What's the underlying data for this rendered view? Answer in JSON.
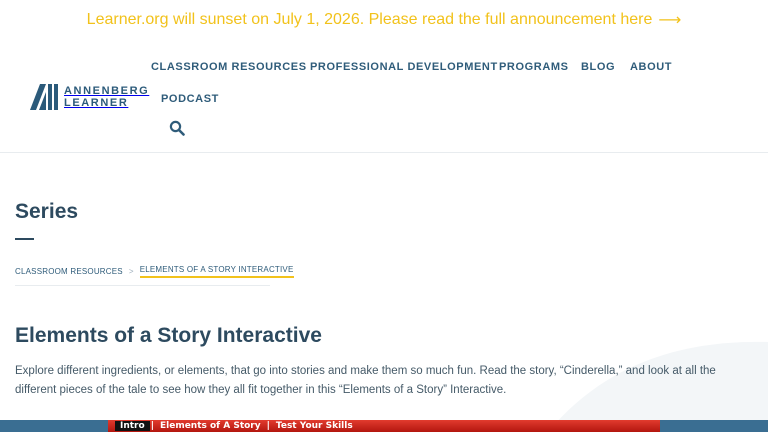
{
  "banner": {
    "text": "Learner.org will sunset on July 1, 2026. Please read the full announcement here",
    "arrow": "⟶"
  },
  "logo": {
    "line1": "ANNENBERG",
    "line2": "LEARNER"
  },
  "nav": {
    "items": [
      "CLASSROOM RESOURCES",
      "PROFESSIONAL DEVELOPMENT",
      "PROGRAMS",
      "BLOG",
      "ABOUT",
      "PODCAST"
    ],
    "search_icon": "search-icon"
  },
  "page": {
    "section_title": "Series",
    "breadcrumb": [
      "CLASSROOM RESOURCES",
      "ELEMENTS OF A STORY INTERACTIVE"
    ],
    "breadcrumb_separator": ">",
    "title": "Elements of a Story Interactive",
    "description": "Explore different ingredients, or elements, that go into stories and make them so much fun. Read the story, “Cinderella,” and look at all the different pieces of the tale to see how they all fit together in this “Elements of a Story” Interactive."
  },
  "interactive": {
    "tabs": [
      "Intro",
      "Elements of A Story",
      "Test Your Skills"
    ],
    "separator": "|",
    "active_tab": "Intro"
  },
  "colors": {
    "banner": "#f2c21b",
    "nav": "#2f5c7a",
    "heading": "#2d4a5f",
    "interactive_bar": "#d4261b",
    "bottom_band": "#3a6e92"
  }
}
